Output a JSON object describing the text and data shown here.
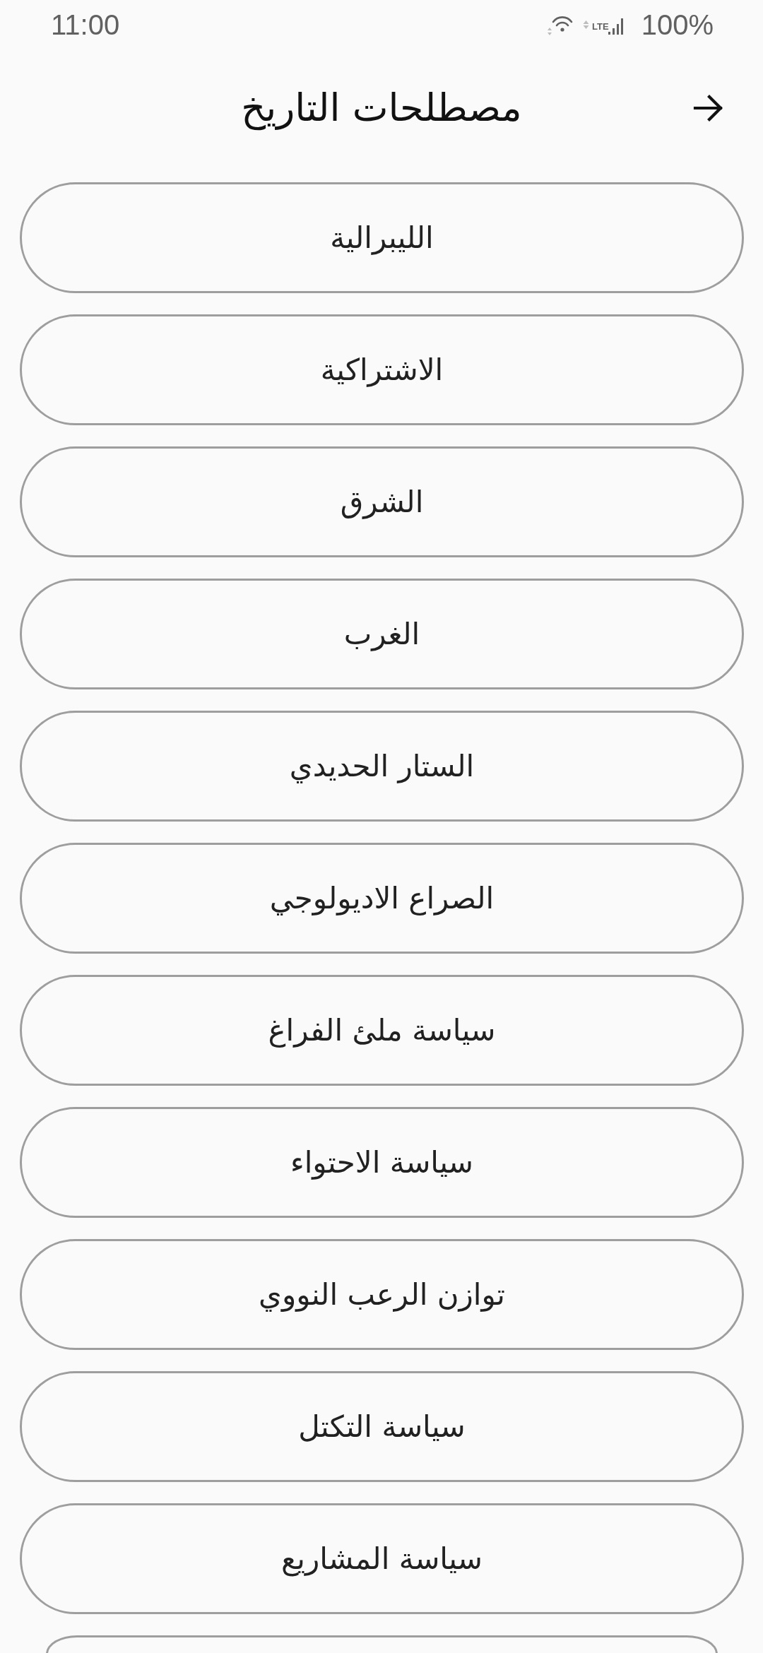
{
  "status_bar": {
    "time": "11:00",
    "network": "LTE",
    "battery": "100%"
  },
  "header": {
    "title": "مصطلحات التاريخ"
  },
  "terms": [
    {
      "label": "الليبرالية",
      "cut_off": false
    },
    {
      "label": "الاشتراكية",
      "cut_off": false
    },
    {
      "label": "الشرق",
      "cut_off": false
    },
    {
      "label": "الغرب",
      "cut_off": false
    },
    {
      "label": "الستار الحديدي",
      "cut_off": false
    },
    {
      "label": "الصراع الاديولوجي",
      "cut_off": false
    },
    {
      "label": "سياسة ملئ الفراغ",
      "cut_off": false
    },
    {
      "label": "سياسة الاحتواء",
      "cut_off": false
    },
    {
      "label": "توازن الرعب النووي",
      "cut_off": false
    },
    {
      "label": "سياسة التكتل",
      "cut_off": false
    },
    {
      "label": "سياسة المشاريع",
      "cut_off": false
    },
    {
      "cut_off": true
    }
  ]
}
